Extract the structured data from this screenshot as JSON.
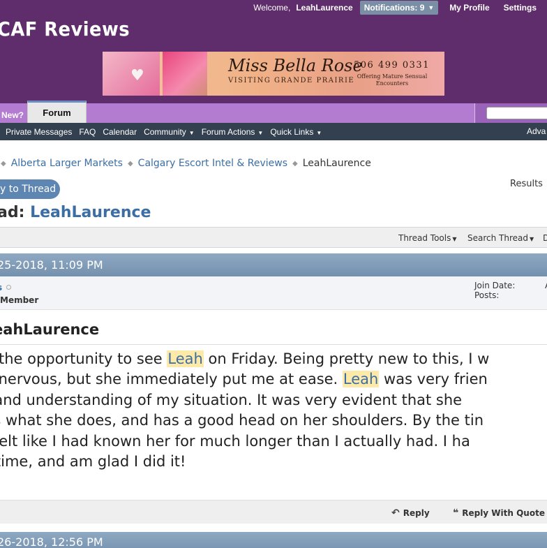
{
  "topbar": {
    "welcome": "Welcome,",
    "username": "LeahLaurence",
    "notifications": "Notifications: 9",
    "my_profile": "My Profile",
    "settings": "Settings"
  },
  "site": {
    "logo_text": "CAF Reviews"
  },
  "banner": {
    "name": "Miss Bella Rose",
    "subtitle": "VISITING GRANDE PRAIRIE",
    "phone": "506 499 0331",
    "offer": "Offering Mature Sensual Encounters"
  },
  "tabs": {
    "whats_new": "New?",
    "forum": "Forum"
  },
  "nav": {
    "items": [
      "Private Messages",
      "FAQ",
      "Calendar",
      "Community",
      "Forum Actions",
      "Quick Links"
    ],
    "advanced": "Adva"
  },
  "breadcrumb": {
    "items": [
      "Alberta Larger Markets",
      "Calgary Escort Intel & Reviews"
    ],
    "current": "LeahLaurence"
  },
  "thread": {
    "reply_button": "y to Thread",
    "results": "Results",
    "title_label": "ad:",
    "title_name": "LeahLaurence"
  },
  "tools": {
    "thread_tools": "Thread Tools",
    "search_thread": "Search Thread",
    "display": "D"
  },
  "post": {
    "date": "25-2018,   11:09 PM",
    "username": "s",
    "user_title": "Member",
    "join_date_label": "Join Date:",
    "posts_label": "Posts:",
    "title": "eahLaurence",
    "highlight": "Leah",
    "lines": [
      {
        "before": "d the opportunity to see ",
        "after": " on Friday. Being pretty new to this, I w",
        "hl": true
      },
      {
        "before": "e nervous, but she immediately put me at ease. ",
        "after": " was very frien",
        "hl": true
      },
      {
        "before": ", and understanding of my situation. It was very evident that she",
        "after": "",
        "hl": false
      },
      {
        "before": "ys what she does, and has a good head on her shoulders. By the tin",
        "after": "",
        "hl": false
      },
      {
        "before": " I felt like I had known her for much longer than I actually had. I ha",
        "after": "",
        "hl": false
      },
      {
        "before": "t time, and am glad I did it!",
        "after": "",
        "hl": false
      }
    ],
    "reply": "Reply",
    "reply_with_quote": "Reply With Quote"
  },
  "next_post": {
    "date": "26-2018,   12:56 PM"
  }
}
